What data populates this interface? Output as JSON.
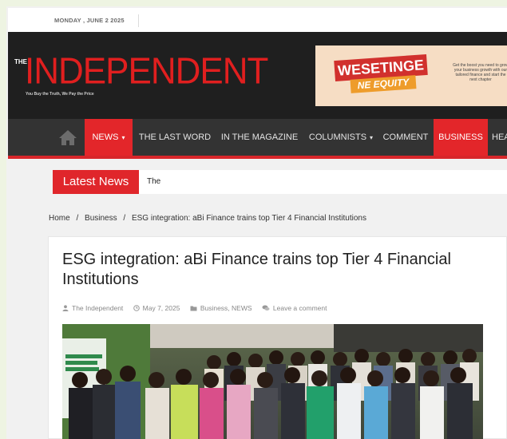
{
  "date_bar": {
    "date": "MONDAY , JUNE 2 2025"
  },
  "logo": {
    "prefix": "THE",
    "name": "INDEPENDENT",
    "tagline": "You Buy the Truth, We Pay the Price"
  },
  "ad": {
    "brand_line1": "WESETINGE",
    "brand_line2": "NE EQUITY",
    "copy": "Get the boost you need to grow your business growth with our tailored finance and start the next chapter"
  },
  "nav": {
    "items": [
      {
        "label": "NEWS",
        "caret": "▾",
        "active": true
      },
      {
        "label": "THE LAST WORD"
      },
      {
        "label": "IN THE MAGAZINE"
      },
      {
        "label": "COLUMNISTS",
        "caret": "▾"
      },
      {
        "label": "COMMENT"
      },
      {
        "label": "BUSINESS",
        "active": true
      },
      {
        "label": "HEA"
      }
    ]
  },
  "ticker": {
    "label": "Latest News",
    "text": "The"
  },
  "breadcrumb": {
    "home": "Home",
    "sep": "/",
    "section": "Business",
    "current": "ESG integration: aBi Finance trains top Tier 4 Financial Institutions"
  },
  "article": {
    "title": "ESG integration: aBi Finance trains top Tier 4 Financial Institutions",
    "author": "The Independent",
    "date": "May 7, 2025",
    "categories": "Business, NEWS",
    "comment_link": "Leave a comment"
  },
  "colors": {
    "accent": "#e3262a",
    "header_bg": "#1f1f1f",
    "nav_bg": "#333333"
  },
  "icons": {
    "home": "home-icon",
    "author": "user-icon",
    "date": "clock-icon",
    "category": "folder-icon",
    "comment": "comment-icon"
  }
}
